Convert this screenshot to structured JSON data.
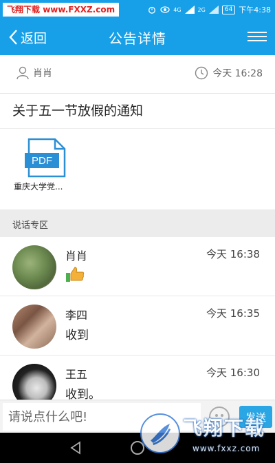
{
  "status_bar": {
    "watermark_brand": "飞翔下载",
    "watermark_url": "www.FXXZ.com",
    "battery": "64",
    "time": "下午4:38",
    "signal1": "4G",
    "signal2": "2G"
  },
  "header": {
    "back_label": "返回",
    "title": "公告详情"
  },
  "notice": {
    "author": "肖肖",
    "time": "今天 16:28",
    "title": "关于五一节放假的通知",
    "attachment": {
      "icon_label": "PDF",
      "name": "重庆大学党..."
    }
  },
  "comments_section": {
    "title": "说话专区",
    "items": [
      {
        "name": "肖肖",
        "time": "今天 16:38",
        "text": "",
        "icon": "thumbs-up-emoji"
      },
      {
        "name": "李四",
        "time": "今天 16:35",
        "text": "收到"
      },
      {
        "name": "王五",
        "time": "今天 16:30",
        "text": "收到。"
      }
    ]
  },
  "input_bar": {
    "placeholder": "请说点什么吧!",
    "send_label": "发送"
  },
  "watermark": {
    "title": "飞翔下载",
    "url": "www.fxxz.com"
  },
  "colors": {
    "primary": "#17a0e8",
    "send": "#2aa6e5"
  }
}
